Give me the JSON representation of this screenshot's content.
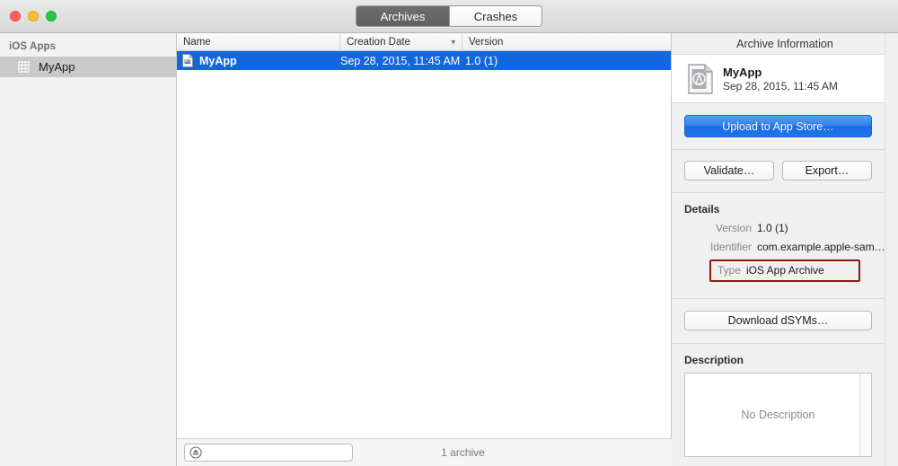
{
  "window": {
    "traffic_lights": [
      {
        "name": "close",
        "color": "#ff5f57"
      },
      {
        "name": "minimize",
        "color": "#febc2e"
      },
      {
        "name": "zoom",
        "color": "#28c840"
      }
    ]
  },
  "toolbar": {
    "segments": [
      {
        "label": "Archives",
        "selected": true
      },
      {
        "label": "Crashes",
        "selected": false
      }
    ]
  },
  "sidebar": {
    "group_label": "iOS Apps",
    "items": [
      {
        "label": "MyApp",
        "icon": "app-grid-icon",
        "selected": true
      }
    ]
  },
  "table": {
    "columns": [
      {
        "label": "Name",
        "sorted": false
      },
      {
        "label": "Creation Date",
        "sorted": true,
        "sort_icon": "chevron-down-icon"
      },
      {
        "label": "Version",
        "sorted": false
      }
    ],
    "rows": [
      {
        "icon": "archive-document-icon",
        "name": "MyApp",
        "creation_date": "Sep 28, 2015, 11:45 AM",
        "version": "1.0 (1)",
        "selected": true
      }
    ],
    "selection_color": "#1266e0"
  },
  "bottom_bar": {
    "filter_icon": "eject-icon",
    "filter_value": "",
    "filter_placeholder": "",
    "status": "1 archive"
  },
  "inspector": {
    "title": "Archive Information",
    "summary": {
      "icon": "app-store-archive-icon",
      "name": "MyApp",
      "date": "Sep 28, 2015, 11:45 AM"
    },
    "primary_button": {
      "label": "Upload to App Store…",
      "color": "#2c7fee"
    },
    "actions": [
      {
        "label": "Validate…"
      },
      {
        "label": "Export…"
      }
    ],
    "details": {
      "title": "Details",
      "rows": [
        {
          "label": "Version",
          "value": "1.0 (1)",
          "highlighted": false
        },
        {
          "label": "Identifier",
          "value": "com.example.apple-sam…",
          "highlighted": false
        },
        {
          "label": "Type",
          "value": "iOS App Archive",
          "highlighted": true
        }
      ],
      "highlight_color": "#8c1c0e"
    },
    "dsym_button": {
      "label": "Download dSYMs…"
    },
    "description": {
      "title": "Description",
      "placeholder": "No Description",
      "value": ""
    }
  }
}
